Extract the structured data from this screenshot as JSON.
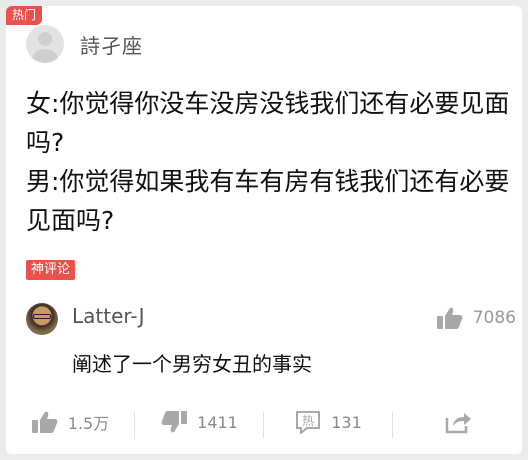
{
  "post": {
    "hot_tag": "热门",
    "author": "詩孑座",
    "lines": [
      "女:你觉得你没车没房没钱我们还有必要见面吗?",
      "男:你觉得如果我有车有房有钱我们还有必要见面吗?"
    ]
  },
  "god_comment": {
    "badge": "神评论",
    "user": "Latter-J",
    "likes": "7086",
    "text": "阐述了一个男穷女丑的事实"
  },
  "actions": {
    "like_count": "1.5万",
    "dislike_count": "1411",
    "hot_icon_text": "热",
    "comment_count": "131"
  },
  "colors": {
    "accent": "#e8524b",
    "icon_gray": "#a8a8a8",
    "background": "#ebebeb"
  }
}
